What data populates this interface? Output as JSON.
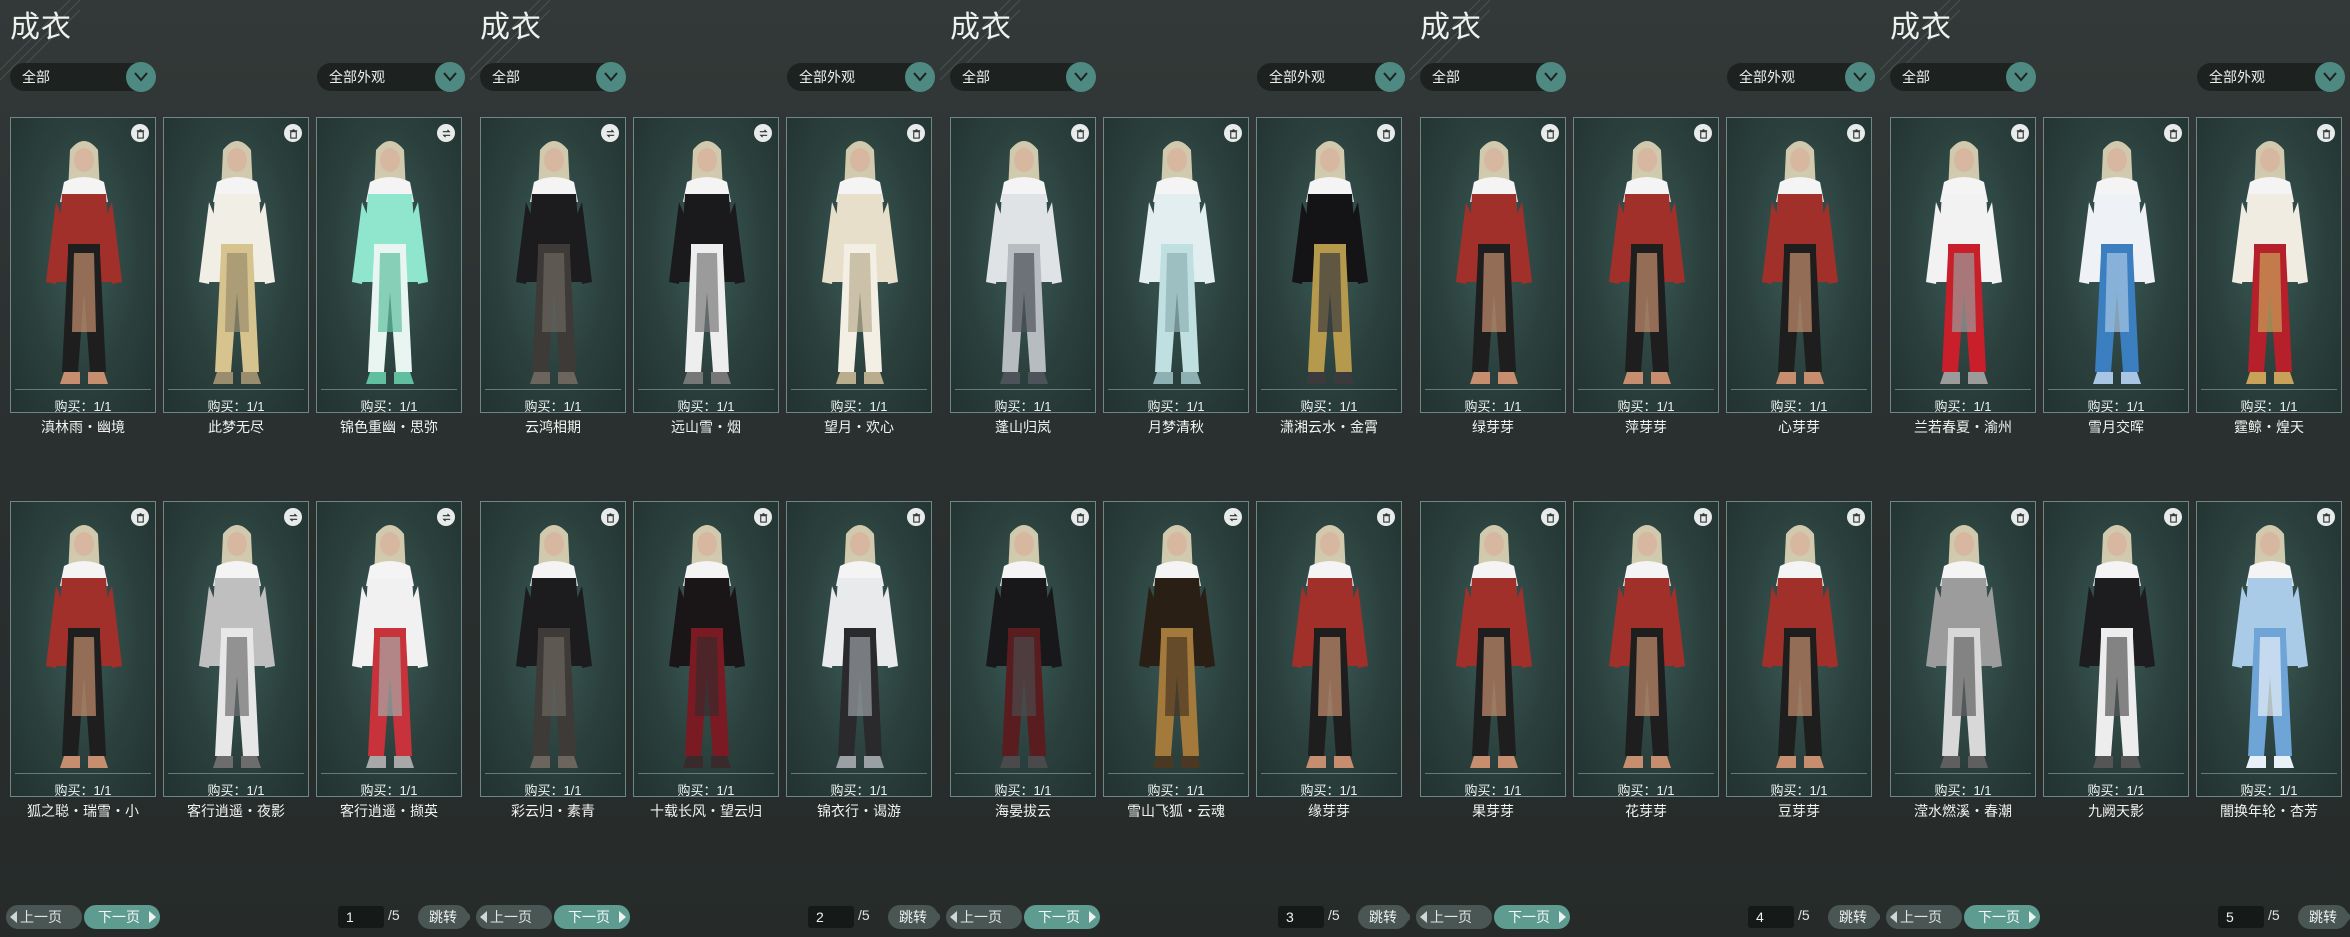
{
  "ui": {
    "title": "成衣",
    "filter_left": "全部",
    "filter_right": "全部外观",
    "prev_label": "上一页",
    "next_label": "下一页",
    "jump_label": "跳转",
    "total_pages": "/5"
  },
  "colors": {
    "accent": "#4e8a81",
    "card_bg": "#2b403d",
    "outfit_palette": {
      "white": [
        "#e9ecef",
        "#c9ced2",
        "#8a8f95"
      ],
      "white_gold": [
        "#f1eee6",
        "#d7c38e",
        "#9a8d6e"
      ],
      "mint": [
        "#8fe6cc",
        "#e8f5f0",
        "#5fbf9f"
      ],
      "dark": [
        "#1c1c1f",
        "#3e3a38",
        "#6b655e"
      ],
      "black_white": [
        "#1a1a1c",
        "#eeeeee",
        "#777777"
      ],
      "cream": [
        "#e7dfca",
        "#f3efe4",
        "#b9ad8e"
      ],
      "ink": [
        "#dfe3e6",
        "#b7bcc1",
        "#4d535a"
      ],
      "ice": [
        "#e3eef0",
        "#c0dfe0",
        "#8fb0b3"
      ],
      "black_gold": [
        "#141416",
        "#b59a4e",
        "#3b3b3d"
      ],
      "red_bare": [
        "#a2302a",
        "#1e1e1e",
        "#c68e6e"
      ],
      "red_white": [
        "#f2f2f2",
        "#c81f2a",
        "#9b9b9b"
      ],
      "blue_white": [
        "#eef2f6",
        "#3b7fc0",
        "#a8c6e3"
      ],
      "red_gold": [
        "#f0ece2",
        "#b5202a",
        "#c9a25a"
      ],
      "gray_white": [
        "#bfbfbf",
        "#e7e7e7",
        "#6d6d6d"
      ],
      "wine": [
        "#1a1516",
        "#7a1b24",
        "#3a2a2c"
      ],
      "white_dark": [
        "#e8eaec",
        "#2a2a2c",
        "#9aa0a4"
      ],
      "black_red": [
        "#18181a",
        "#5a1d1f",
        "#4a4a4c"
      ],
      "brown_gold": [
        "#2a1f15",
        "#a47a3c",
        "#4a3822"
      ],
      "gray_silver": [
        "#9c9c9c",
        "#d8d8d8",
        "#5f5f5f"
      ],
      "black_silver": [
        "#1d1d1f",
        "#ededed",
        "#555555"
      ],
      "light_blue": [
        "#a9cbe8",
        "#6fa4d6",
        "#e9f1f8"
      ],
      "white_red": [
        "#f1f1f1",
        "#c8323a",
        "#a8a8a8"
      ]
    }
  },
  "pages": [
    {
      "page": "1",
      "items": [
        {
          "name": "滇林雨・幽境",
          "buy": "购买：1/1",
          "icon": "trash-icon",
          "style": "red_bare"
        },
        {
          "name": "此梦无尽",
          "buy": "购买：1/1",
          "icon": "trash-icon",
          "style": "white_gold"
        },
        {
          "name": "锦色重幽・思弥",
          "buy": "购买：1/1",
          "icon": "exchange-icon",
          "style": "mint"
        },
        {
          "name": "狐之聪・瑞雪・小",
          "buy": "购买：1/1",
          "icon": "trash-icon",
          "style": "red_bare"
        },
        {
          "name": "客行逍遥・夜影",
          "buy": "购买：1/1",
          "icon": "exchange-icon",
          "style": "gray_white"
        },
        {
          "name": "客行逍遥・撷英",
          "buy": "购买：1/1",
          "icon": "exchange-icon",
          "style": "white_red"
        }
      ]
    },
    {
      "page": "2",
      "items": [
        {
          "name": "云鸿相期",
          "buy": "购买：1/1",
          "icon": "exchange-icon",
          "style": "dark"
        },
        {
          "name": "远山雪・烟",
          "buy": "购买：1/1",
          "icon": "exchange-icon",
          "style": "black_white"
        },
        {
          "name": "望月・欢心",
          "buy": "购买：1/1",
          "icon": "trash-icon",
          "style": "cream"
        },
        {
          "name": "彩云归・素青",
          "buy": "购买：1/1",
          "icon": "trash-icon",
          "style": "dark"
        },
        {
          "name": "十载长风・望云归",
          "buy": "购买：1/1",
          "icon": "trash-icon",
          "style": "wine"
        },
        {
          "name": "锦衣行・谒游",
          "buy": "购买：1/1",
          "icon": "trash-icon",
          "style": "white_dark"
        }
      ]
    },
    {
      "page": "3",
      "items": [
        {
          "name": "蓬山归岚",
          "buy": "购买：1/1",
          "icon": "trash-icon",
          "style": "ink"
        },
        {
          "name": "月梦清秋",
          "buy": "购买：1/1",
          "icon": "trash-icon",
          "style": "ice"
        },
        {
          "name": "潇湘云水・金霄",
          "buy": "购买：1/1",
          "icon": "trash-icon",
          "style": "black_gold"
        },
        {
          "name": "海晏拔云",
          "buy": "购买：1/1",
          "icon": "trash-icon",
          "style": "black_red"
        },
        {
          "name": "雪山飞狐・云魂",
          "buy": "购买：1/1",
          "icon": "exchange-icon",
          "style": "brown_gold"
        },
        {
          "name": "缘芽芽",
          "buy": "购买：1/1",
          "icon": "trash-icon",
          "style": "red_bare"
        }
      ]
    },
    {
      "page": "4",
      "items": [
        {
          "name": "绿芽芽",
          "buy": "购买：1/1",
          "icon": "trash-icon",
          "style": "red_bare"
        },
        {
          "name": "萍芽芽",
          "buy": "购买：1/1",
          "icon": "trash-icon",
          "style": "red_bare"
        },
        {
          "name": "心芽芽",
          "buy": "购买：1/1",
          "icon": "trash-icon",
          "style": "red_bare"
        },
        {
          "name": "果芽芽",
          "buy": "购买：1/1",
          "icon": "trash-icon",
          "style": "red_bare"
        },
        {
          "name": "花芽芽",
          "buy": "购买：1/1",
          "icon": "trash-icon",
          "style": "red_bare"
        },
        {
          "name": "豆芽芽",
          "buy": "购买：1/1",
          "icon": "trash-icon",
          "style": "red_bare"
        }
      ]
    },
    {
      "page": "5",
      "items": [
        {
          "name": "兰若春夏・渝州",
          "buy": "购买：1/1",
          "icon": "trash-icon",
          "style": "red_white"
        },
        {
          "name": "雪月交晖",
          "buy": "购买：1/1",
          "icon": "trash-icon",
          "style": "blue_white"
        },
        {
          "name": "霆鲸・煌天",
          "buy": "购买：1/1",
          "icon": "trash-icon",
          "style": "red_gold"
        },
        {
          "name": "滢水燃溪・春潮",
          "buy": "购买：1/1",
          "icon": "trash-icon",
          "style": "gray_silver"
        },
        {
          "name": "九阙天影",
          "buy": "购买：1/1",
          "icon": "trash-icon",
          "style": "black_silver"
        },
        {
          "name": "闇换年轮・杏芳",
          "buy": "购买：1/1",
          "icon": "trash-icon",
          "style": "light_blue"
        }
      ]
    }
  ]
}
